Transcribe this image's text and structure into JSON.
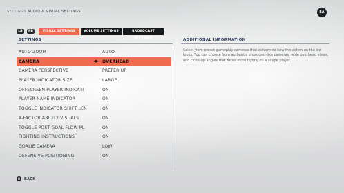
{
  "header": {
    "breadcrumb_prefix": "SETTINGS",
    "breadcrumb_title": "AUDIO & VISUAL SETTINGS",
    "logo": "EA"
  },
  "tabs": {
    "left_bumper": "LB",
    "right_bumper": "RB",
    "items": [
      {
        "label": "VISUAL SETTINGS",
        "active": true
      },
      {
        "label": "VOLUME SETTINGS",
        "active": false
      },
      {
        "label": "BROADCAST SETTINGS",
        "active": false
      }
    ]
  },
  "settings": {
    "heading": "SETTINGS",
    "rows": [
      {
        "label": "AUTO ZOOM",
        "value": "AUTO"
      },
      {
        "label": "CAMERA",
        "value": "OVERHEAD",
        "selected": true
      },
      {
        "label": "CAMERA PERSPECTIVE",
        "value": "PREFER UP"
      },
      {
        "label": "PLAYER INDICATOR SIZE",
        "value": "LARGE"
      },
      {
        "label": "OFFSCREEN PLAYER INDICATI",
        "value": "ON"
      },
      {
        "label": "PLAYER NAME INDICATOR",
        "value": "ON"
      },
      {
        "label": "TOGGLE INDICATOR SHIFT LEN",
        "value": "ON"
      },
      {
        "label": "X-FACTOR ABILITY VISUALS",
        "value": "ON"
      },
      {
        "label": "TOGGLE POST-GOAL FLOW PL",
        "value": "ON"
      },
      {
        "label": "FIGHTING INSTRUCTIONS",
        "value": "ON"
      },
      {
        "label": "GOALIE CAMERA",
        "value": "LOW"
      },
      {
        "label": "DEFENSIVE POSITIONING",
        "value": "ON"
      }
    ]
  },
  "info": {
    "heading": "ADDITIONAL INFORMATION",
    "text": "Select from preset gameplay cameras that determine how the action on the ice looks. You can choose from authentic broadcast-like cameras, wide overhead views, and close-up angles that focus more tightly on a single player."
  },
  "footer": {
    "button": "B",
    "back_label": "BACK"
  },
  "colors": {
    "accent": "#f06a4f",
    "heading": "#2f3f66"
  }
}
